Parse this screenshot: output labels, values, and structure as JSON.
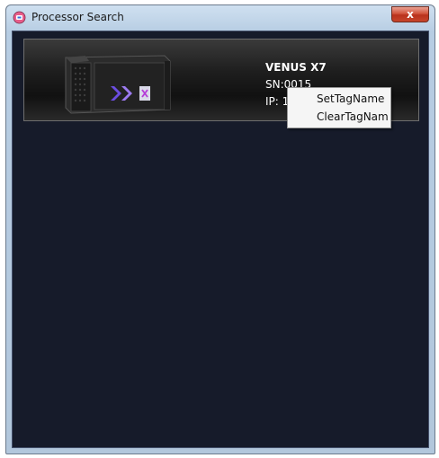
{
  "window": {
    "title": "Processor Search",
    "close_label": "x"
  },
  "device": {
    "name": "VENUS X7",
    "sn": "SN:0015",
    "ip": "IP: 19"
  },
  "context_menu": {
    "items": [
      {
        "label": "SetTagName"
      },
      {
        "label": "ClearTagNam"
      }
    ]
  },
  "colors": {
    "client_background": "#161b2a",
    "close_button": "#c7452c",
    "menu_background": "#f5f5f5"
  }
}
